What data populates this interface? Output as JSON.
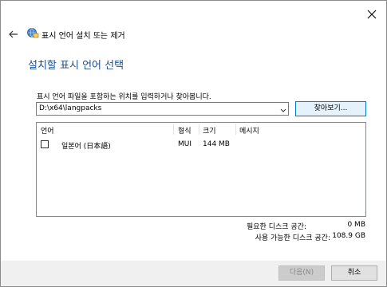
{
  "nav": {
    "title": "표시 언어 설치 또는 제거"
  },
  "heading": "설치할 표시 언어 선택",
  "instruction": "표시 언어 파일을 포함하는 위치를 입력하거나 찾아봅니다.",
  "path": {
    "value": "D:\\x64\\langpacks"
  },
  "browse_label": "찾아보기...",
  "list": {
    "headers": {
      "language": "언어",
      "format": "형식",
      "size": "크기",
      "message": "메시지"
    },
    "rows": [
      {
        "language": "일본어 (日本語)",
        "format": "MUI",
        "size": "144 MB",
        "message": "",
        "checked": false
      }
    ]
  },
  "space": {
    "required_label": "필요한 디스크 공간:",
    "required_value": "0 MB",
    "available_label": "사용 가능한 디스크 공간:",
    "available_value": "108.9 GB"
  },
  "buttons": {
    "next": "다음(N)",
    "cancel": "취소"
  },
  "colors": {
    "heading": "#1e4e8c",
    "accent": "#0078d7",
    "footer": "#f0f0f0"
  }
}
